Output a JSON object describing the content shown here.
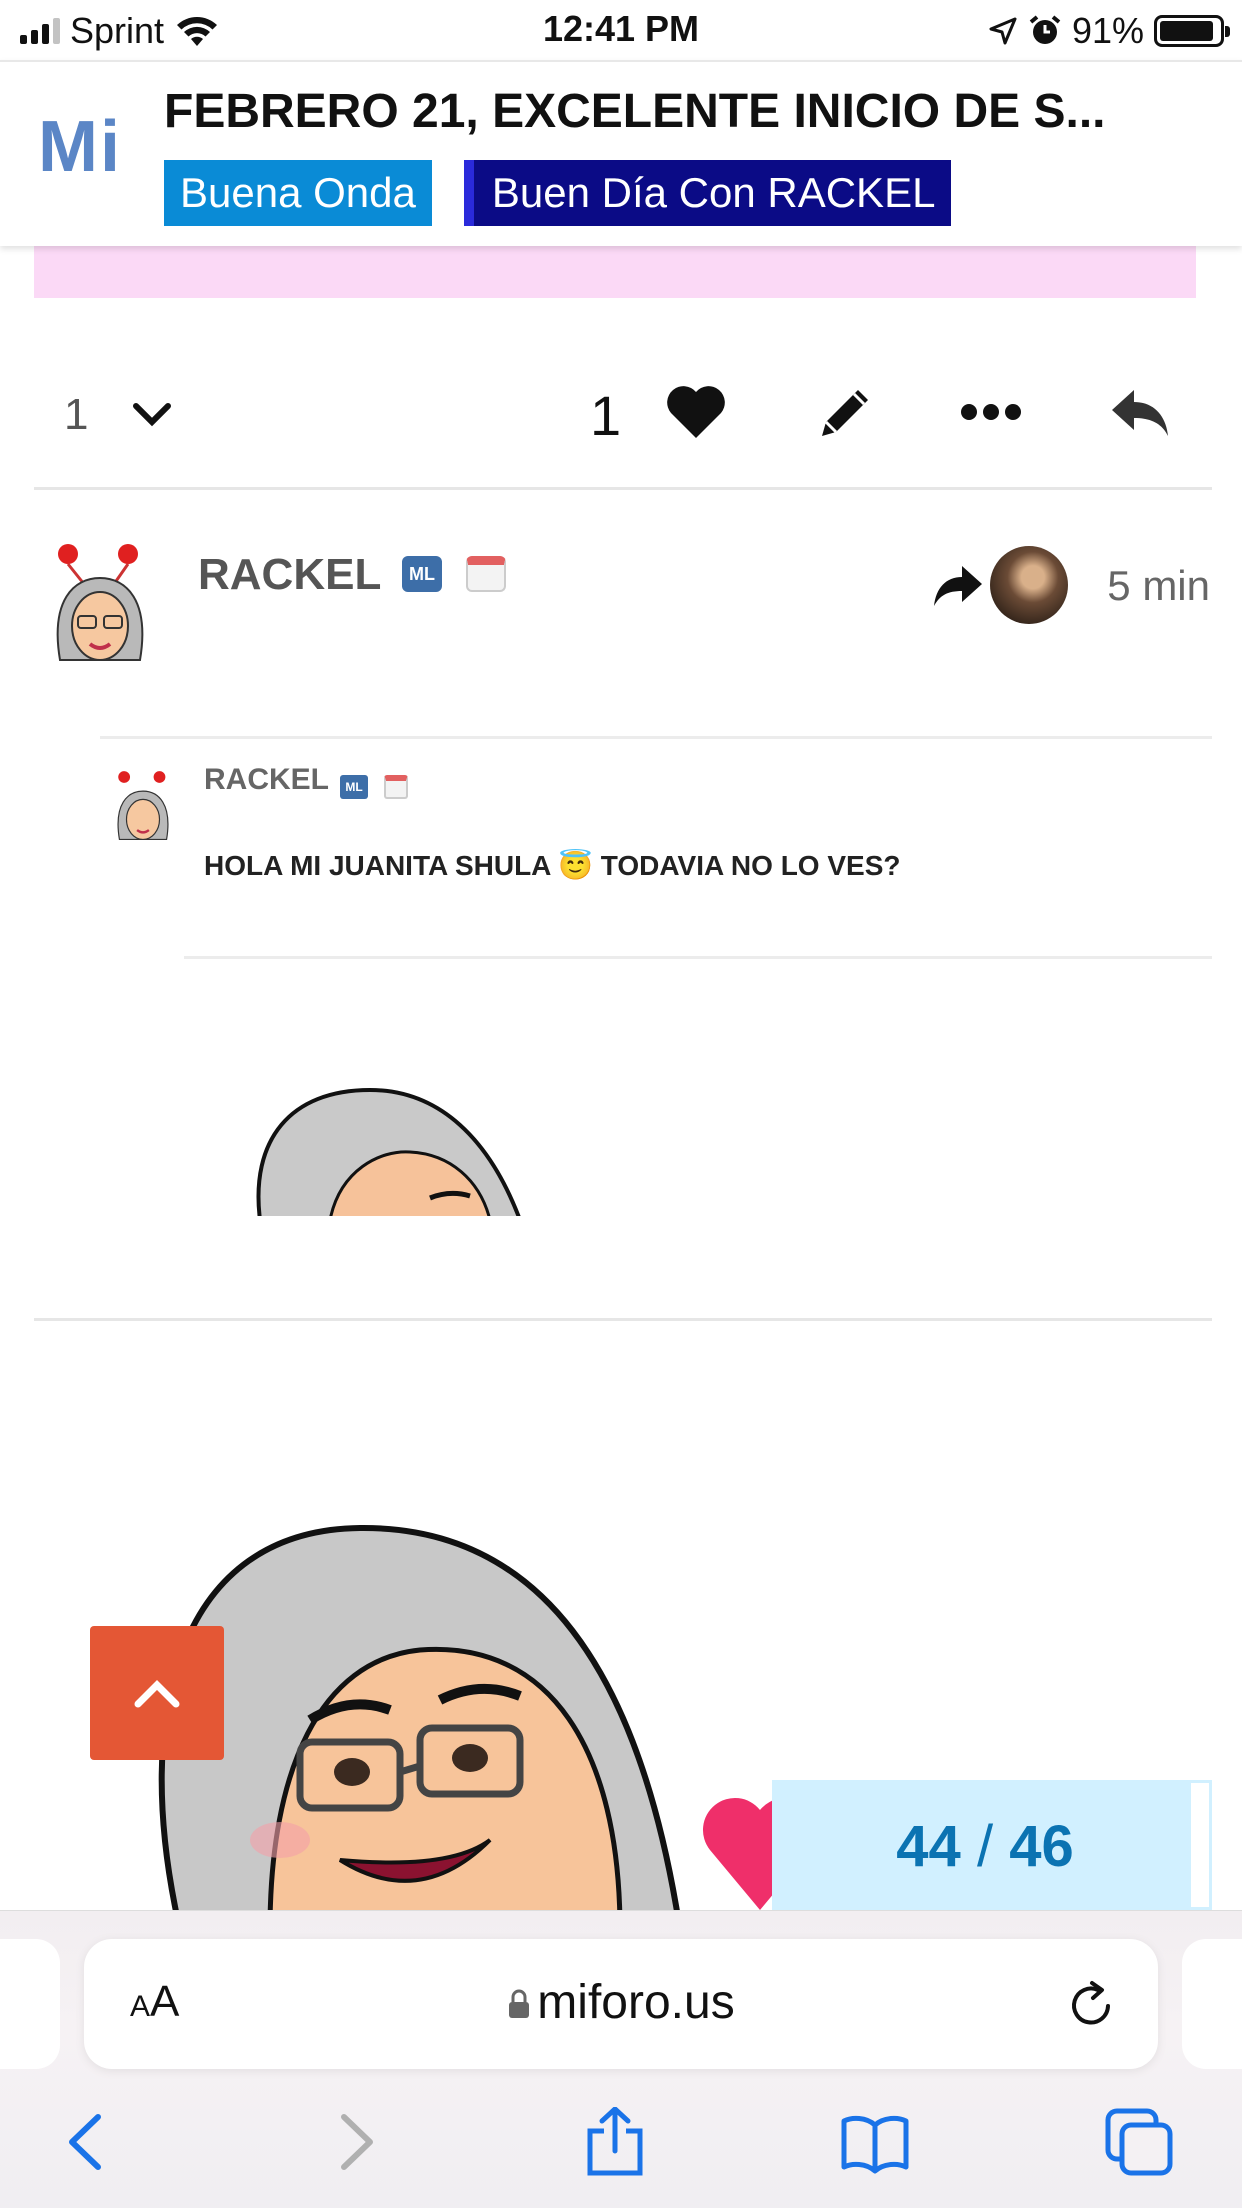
{
  "status_bar": {
    "carrier": "Sprint",
    "time": "12:41 PM",
    "battery": "91%"
  },
  "header": {
    "logo": "Mi",
    "topic_title": "FEBRERO 21, EXCELENTE INICIO DE S...",
    "categories": [
      "Buena Onda",
      "Buen Día Con RACKEL"
    ]
  },
  "controls": {
    "reply_count": "1",
    "like_count": "1"
  },
  "post": {
    "username": "RACKEL",
    "badge": "ML",
    "time": "5 min",
    "quote": {
      "username": "RACKEL",
      "text": "HOLA MI JUANITA SHULA 😇 TODAVIA NO LO VES?"
    }
  },
  "progress": {
    "current": "44",
    "separator": "/",
    "total": "46"
  },
  "browser": {
    "text_size": "AA",
    "url": "miforo.us"
  },
  "colors": {
    "logo": "#5b86c6",
    "category_1": "#0a8bd6",
    "category_2": "#0b0b86",
    "scroll_button": "#e45735",
    "progress_bg": "#d1f0ff",
    "progress_text": "#0b73b2"
  }
}
